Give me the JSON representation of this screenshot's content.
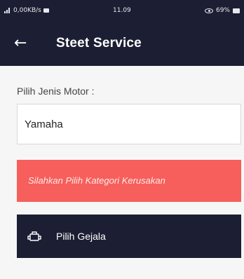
{
  "status_bar": {
    "network_speed": "0,00KB/s",
    "time": "11.09",
    "battery": "69%"
  },
  "app_bar": {
    "back_glyph": "←",
    "title": "Steet Service"
  },
  "form": {
    "motor_label": "Pilih Jenis Motor :",
    "motor_value": "Yamaha"
  },
  "alert": {
    "text": "Silahkan Pilih Kategori Kerusakan",
    "color": "#f65f5b"
  },
  "gejala_button": {
    "label": "Pilih Gejala",
    "icon": "engine-icon"
  },
  "colors": {
    "primary": "#1c1f33",
    "alert": "#f65f5b",
    "background": "#f6f6f6"
  }
}
